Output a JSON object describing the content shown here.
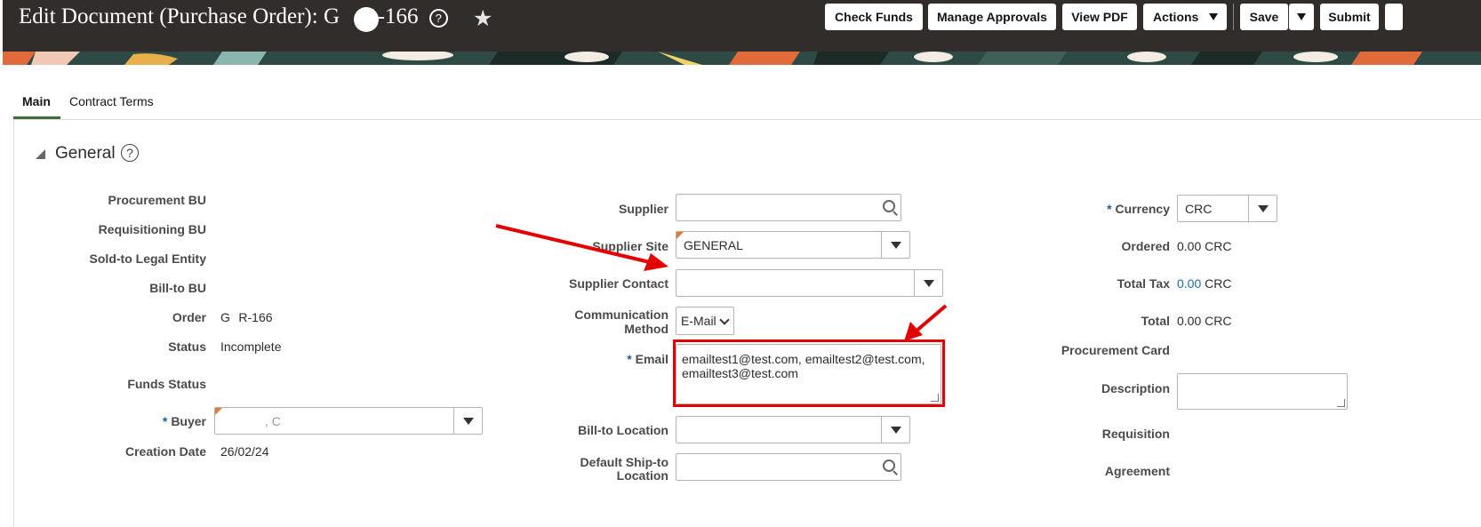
{
  "header": {
    "title": "Edit Document (Purchase Order): G",
    "title_suffix": "R-166",
    "help_icon": "?",
    "favorite_icon": "★",
    "buttons": {
      "check_funds": "Check Funds",
      "manage_approvals": "Manage Approvals",
      "view_pdf": "View PDF",
      "actions": "Actions",
      "save": "Save",
      "submit": "Submit"
    }
  },
  "tabs": [
    {
      "label": "Main",
      "active": true
    },
    {
      "label": "Contract Terms",
      "active": false
    }
  ],
  "section": {
    "title": "General",
    "help": "?"
  },
  "left": {
    "procurement_bu_label": "Procurement BU",
    "requisitioning_bu_label": "Requisitioning BU",
    "sold_to_label": "Sold-to Legal Entity",
    "bill_to_bu_label": "Bill-to BU",
    "order_label": "Order",
    "order_value": "G   R-166",
    "status_label": "Status",
    "status_value": "Incomplete",
    "funds_status_label": "Funds Status",
    "buyer_label": "Buyer",
    "buyer_required": "*",
    "buyer_value": ", C",
    "creation_date_label": "Creation Date",
    "creation_date_value": "26/02/24"
  },
  "middle": {
    "supplier_label": "Supplier",
    "supplier_value": "",
    "supplier_site_label": "Supplier Site",
    "supplier_site_value": "GENERAL",
    "supplier_contact_label": "Supplier Contact",
    "supplier_contact_value": "",
    "comm_method_label_1": "Communication",
    "comm_method_label_2": "Method",
    "comm_method_value": "E-Mail",
    "email_label": "Email",
    "email_required": "*",
    "email_line1": "emailtest1@test.com, emailtest2@test.com,",
    "email_line2": "emailtest3@test.com",
    "bill_to_location_label": "Bill-to Location",
    "default_ship_to_label_1": "Default Ship-to",
    "default_ship_to_label_2": "Location"
  },
  "right": {
    "currency_label": "Currency",
    "currency_required": "*",
    "currency_value": "CRC",
    "ordered_label": "Ordered",
    "ordered_value": "0.00",
    "ordered_currency": "CRC",
    "total_tax_label": "Total Tax",
    "total_tax_value": "0.00",
    "total_tax_currency": "CRC",
    "total_label": "Total",
    "total_value": "0.00",
    "total_currency": "CRC",
    "procurement_card_label": "Procurement Card",
    "description_label": "Description",
    "requisition_label": "Requisition",
    "agreement_label": "Agreement"
  },
  "colors": {
    "header_bg": "#312d2a",
    "active_tab": "#3f6d3a",
    "required": "#1a5e9a",
    "annotation_red": "#e30000"
  }
}
